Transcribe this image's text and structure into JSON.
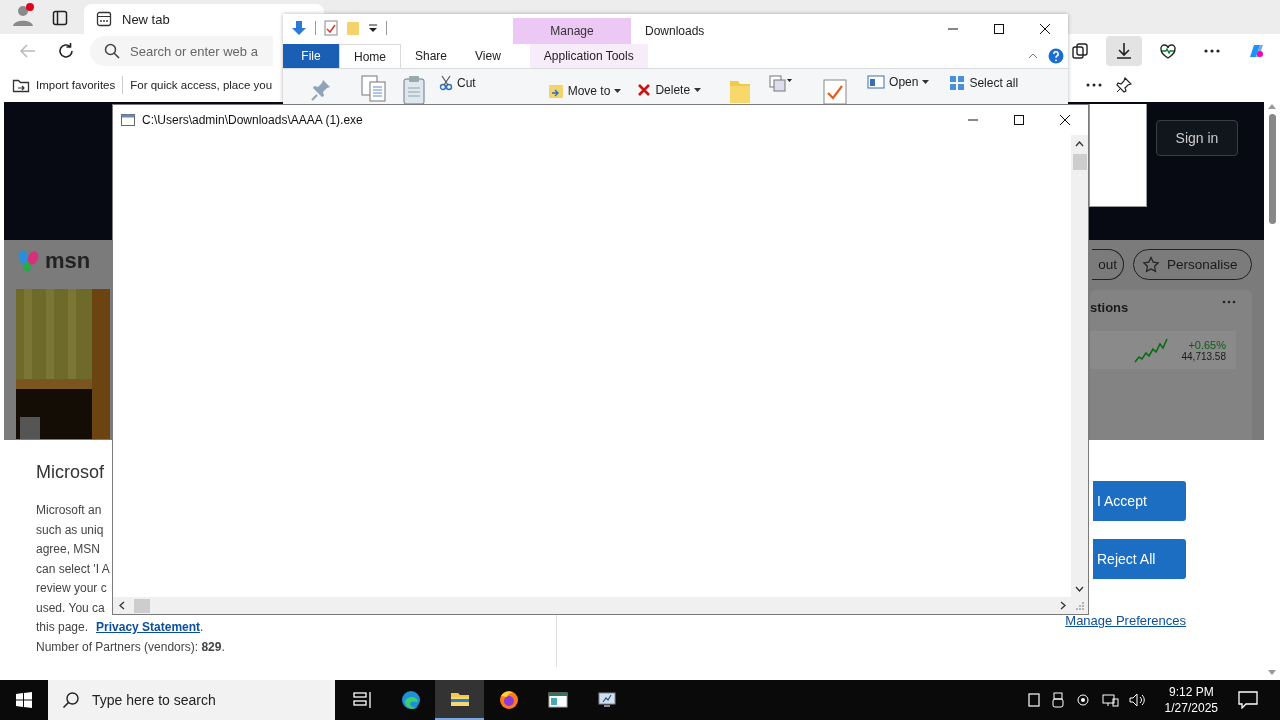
{
  "browser": {
    "tab": {
      "title": "New tab",
      "selected": true
    },
    "address_placeholder": "Search or enter web a",
    "favorites": [
      {
        "kind": "import",
        "label": "Import favorites"
      },
      {
        "kind": "hint",
        "label": "For quick access, place you"
      }
    ],
    "page": {
      "logo": "msn",
      "sign_in": "Sign in",
      "layout_button": "out",
      "personalise_button": "Personalise",
      "widget": {
        "title": "stions",
        "change": "+0.65%",
        "value": "44,713.58"
      },
      "consent": {
        "title": "Microsof",
        "lines": [
          "Microsoft an",
          "such as uniq",
          "agree, MSN",
          "can select 'I A",
          "review your c",
          "used. You ca"
        ],
        "last_line": {
          "text": "this page.",
          "link": "Privacy Statement",
          "after": "."
        },
        "partners": "Number of Partners (vendors): **829**.",
        "buttons": [
          "I Accept",
          "Reject All"
        ],
        "manage_link": "Manage Preferences"
      }
    }
  },
  "explorer": {
    "title": "Downloads",
    "context_tab": "Manage",
    "tabs": [
      {
        "label": "File",
        "kind": "file",
        "selected": false
      },
      {
        "label": "Home",
        "kind": "tab",
        "selected": true
      },
      {
        "label": "Share",
        "kind": "tab",
        "selected": false
      },
      {
        "label": "View",
        "kind": "tab",
        "selected": false
      },
      {
        "label": "Application Tools",
        "kind": "context",
        "selected": false
      }
    ],
    "commands": [
      {
        "kind": "pin"
      },
      {
        "kind": "copy"
      },
      {
        "kind": "paste"
      },
      {
        "kind": "cut",
        "label": "Cut"
      },
      {
        "kind": "move",
        "label": "Move to"
      },
      {
        "kind": "delete",
        "label": "Delete"
      },
      {
        "kind": "folder"
      },
      {
        "kind": "copyto"
      },
      {
        "kind": "properties"
      },
      {
        "kind": "open",
        "label": "Open"
      },
      {
        "kind": "selectall",
        "label": "Select all"
      }
    ]
  },
  "console": {
    "title": "C:\\Users\\admin\\Downloads\\AAAA (1).exe"
  },
  "taskbar": {
    "search_placeholder": "Type here to search",
    "apps": [
      {
        "kind": "taskview",
        "selected": false
      },
      {
        "kind": "edge",
        "selected": false
      },
      {
        "kind": "explorer",
        "selected": true
      },
      {
        "kind": "firefox",
        "selected": false
      },
      {
        "kind": "window",
        "selected": false
      },
      {
        "kind": "monitor",
        "selected": false
      }
    ],
    "time": "9:12 PM",
    "date": "1/27/2025"
  }
}
